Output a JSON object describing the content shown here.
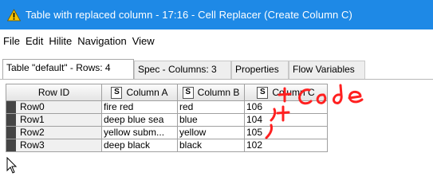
{
  "window": {
    "title": "Table with replaced column - 17:16 - Cell Replacer (Create Column C)",
    "warning_icon": "warning-triangle-icon",
    "titlebar_color": "#1e89e6"
  },
  "menu": [
    "File",
    "Edit",
    "Hilite",
    "Navigation",
    "View"
  ],
  "tabs": [
    "Table \"default\" - Rows: 4",
    "Spec - Columns: 3",
    "Properties",
    "Flow Variables"
  ],
  "table": {
    "row_id_header": "Row ID",
    "type_marker": "S",
    "columns": [
      "Column A",
      "Column B",
      "Column C"
    ],
    "rows": [
      {
        "id": "Row0",
        "cells": [
          "fire red",
          "red",
          "106"
        ]
      },
      {
        "id": "Row1",
        "cells": [
          "deep blue sea",
          "blue",
          "104"
        ]
      },
      {
        "id": "Row2",
        "cells": [
          "yellow subm...",
          "yellow",
          "105"
        ]
      },
      {
        "id": "Row3",
        "cells": [
          "deep black",
          "black",
          "102"
        ]
      }
    ]
  },
  "annotation": {
    "text": "+ Code",
    "color": "#ff2020"
  }
}
